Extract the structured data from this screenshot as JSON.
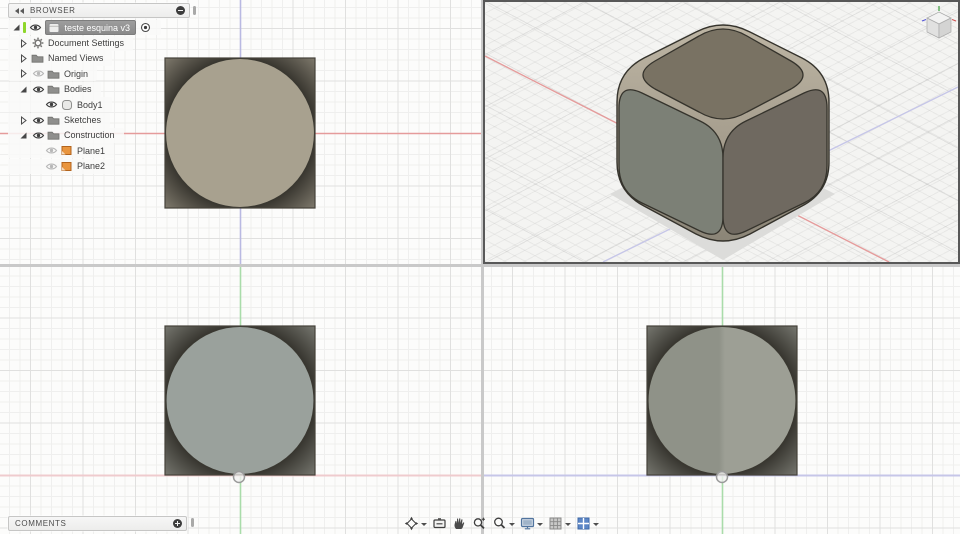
{
  "browser": {
    "title": "BROWSER",
    "header_icons": [
      "collapse-double-arrow",
      "minimize-circle"
    ],
    "tree": [
      {
        "label": "teste esquina v3",
        "level": 0,
        "expander": "open",
        "eye": "on",
        "icon": "component",
        "selected": true,
        "active_bar": true,
        "radio": true
      },
      {
        "label": "Document Settings",
        "level": 1,
        "expander": "closed",
        "eye": "none",
        "icon": "gear"
      },
      {
        "label": "Named Views",
        "level": 1,
        "expander": "closed",
        "eye": "none",
        "icon": "folder"
      },
      {
        "label": "Origin",
        "level": 1,
        "expander": "closed",
        "eye": "dim",
        "icon": "folder"
      },
      {
        "label": "Bodies",
        "level": 1,
        "expander": "open",
        "eye": "on",
        "icon": "folder"
      },
      {
        "label": "Body1",
        "level": 2,
        "expander": "none",
        "eye": "on",
        "icon": "body"
      },
      {
        "label": "Sketches",
        "level": 1,
        "expander": "closed",
        "eye": "on",
        "icon": "folder"
      },
      {
        "label": "Construction",
        "level": 1,
        "expander": "open",
        "eye": "on",
        "icon": "folder"
      },
      {
        "label": "Plane1",
        "level": 2,
        "expander": "none",
        "eye": "dim",
        "icon": "plane"
      },
      {
        "label": "Plane2",
        "level": 2,
        "expander": "none",
        "eye": "dim",
        "icon": "plane"
      }
    ]
  },
  "comments": {
    "title": "COMMENTS",
    "header_icons": [
      "add-circle"
    ]
  },
  "navbar": {
    "items": [
      {
        "name": "orbit",
        "icon": "orbit-icon",
        "dropdown": true
      },
      {
        "name": "look-at",
        "icon": "look-at-icon",
        "dropdown": false
      },
      {
        "name": "pan",
        "icon": "pan-hand-icon",
        "dropdown": false
      },
      {
        "name": "zoom",
        "icon": "zoom-icon",
        "dropdown": false
      },
      {
        "name": "fit",
        "icon": "fit-icon",
        "dropdown": true
      },
      {
        "name": "display-settings",
        "icon": "display-settings-icon",
        "dropdown": true
      },
      {
        "name": "grid-and-snaps",
        "icon": "grid-snaps-icon",
        "dropdown": true
      },
      {
        "name": "viewports",
        "icon": "viewports-icon",
        "dropdown": true
      }
    ]
  },
  "viewports": {
    "layout": "2x2",
    "active": "top-right",
    "content": "rounded cube body shown in three orthographic views and one isometric view with view cube"
  },
  "colors": {
    "active-green": "#8ed62a",
    "select-bg": "#9d9d9d",
    "plane-orange": "#e9953e",
    "axis-red": "#e59b9b",
    "axis-violet": "#b9b9e2",
    "axis-green": "#a9dcaa",
    "axis-pink": "#efcbce",
    "axis-lavender": "#c6c6e8",
    "face-top-view": "#a8a18f",
    "face-front-view": "#9aa19c",
    "face-side-left": "#8f9288",
    "face-side-right": "#9d9f95",
    "iso-face-top": "#797263",
    "iso-face-left": "#7c8076",
    "iso-face-right": "#6f6960",
    "fillet-light": "#bdb5a4",
    "fillet-dark": "#8b8577",
    "shadow": "#dcdcda",
    "corner-dark": "#2f2d27",
    "corner-light": "#8d8779",
    "active-border": "#585858"
  }
}
